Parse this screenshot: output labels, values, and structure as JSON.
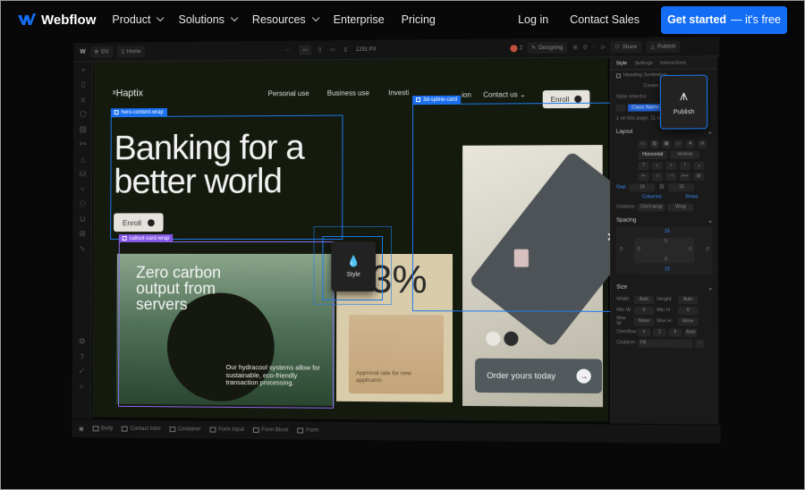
{
  "nav": {
    "brand": "Webflow",
    "items": [
      {
        "label": "Product",
        "has_dropdown": true
      },
      {
        "label": "Solutions",
        "has_dropdown": true
      },
      {
        "label": "Resources",
        "has_dropdown": true
      },
      {
        "label": "Enterprise",
        "has_dropdown": false
      },
      {
        "label": "Pricing",
        "has_dropdown": false
      }
    ],
    "login": "Log in",
    "contact": "Contact Sales",
    "cta_bold": "Get started",
    "cta_rest": "— it's free",
    "cta_color": "#146ef5"
  },
  "designer": {
    "topbar": {
      "locale": "EN",
      "page": "Home",
      "width_readout": "1291 PX",
      "collaborators": "2",
      "mode": "Designing",
      "share": "Share",
      "publish": "Publish"
    },
    "leftbar_icons": [
      "add-icon",
      "pages-icon",
      "navigator-icon",
      "components-icon",
      "assets-icon",
      "variables-icon",
      "cms-icon",
      "database-icon",
      "logic-icon",
      "users-icon",
      "ecommerce-icon",
      "apps-icon",
      "activity-icon",
      "settings-icon",
      "help-icon",
      "checklist-icon",
      "search-icon"
    ],
    "breadcrumbs": [
      "Body",
      "Contact Intro",
      "Container",
      "Form Input",
      "Form Block",
      "Form"
    ],
    "canvas": {
      "brand": "Haptix",
      "site_nav": [
        "Personal use",
        "Business use",
        "Investi",
        "ion",
        "Contact us"
      ],
      "enroll_top": "Enroll",
      "hero_title_line1": "Banking for a",
      "hero_title_line2": "better world",
      "enroll_hero": "Enroll",
      "green_card_title": "Zero carbon output from servers",
      "green_card_text": "Our hydracool systems allow for sustainable, eco-friendly transaction processing.",
      "stat_value": "3%",
      "stat_text": "Approval rate for new applicants",
      "order_cta": "Order yours today",
      "swatches": [
        "#e8e6e0",
        "#2a2c2e"
      ]
    },
    "selection_tags": {
      "hero": "hero-content-wrap",
      "spline": "3d-spline-card",
      "callout": "callout-card-wrap"
    },
    "popups": {
      "publish": "Publish",
      "style": "Style"
    },
    "right_panel": {
      "tabs": [
        "Style",
        "Settings",
        "Interactions"
      ],
      "heading": "Heading Jumbotron",
      "create": "Create component",
      "style_selector": "Style selector",
      "class_name": "Class Name",
      "usage": "1 on this page, 11 on other pages",
      "layout": "Layout",
      "direction": [
        "Horizontal",
        "Vertical"
      ],
      "gap_label": "Gap",
      "gap_col": "16",
      "gap_row": "16",
      "columns": "Columns",
      "rows": "Rows",
      "children_label": "Children",
      "wrap_opts": [
        "Don't wrap",
        "Wrap"
      ],
      "spacing": "Spacing",
      "margin_top": "15",
      "margin_bottom": "15",
      "margin_left": "0",
      "margin_right": "0",
      "padding": [
        "0",
        "0",
        "0",
        "0"
      ],
      "size": "Size",
      "width_label": "Width",
      "width_val": "Auto",
      "height_label": "Height",
      "height_val": "Auto",
      "minw_label": "Min W",
      "minw_val": "0",
      "minh_label": "Min H",
      "minh_val": "0",
      "maxw_label": "Max W",
      "maxw_val": "None",
      "maxh_label": "Max H",
      "maxh_val": "None",
      "overflow_label": "Overflow",
      "overflow_auto": "Auto",
      "children_fit_label": "Children",
      "children_fit_val": "Fill"
    }
  }
}
